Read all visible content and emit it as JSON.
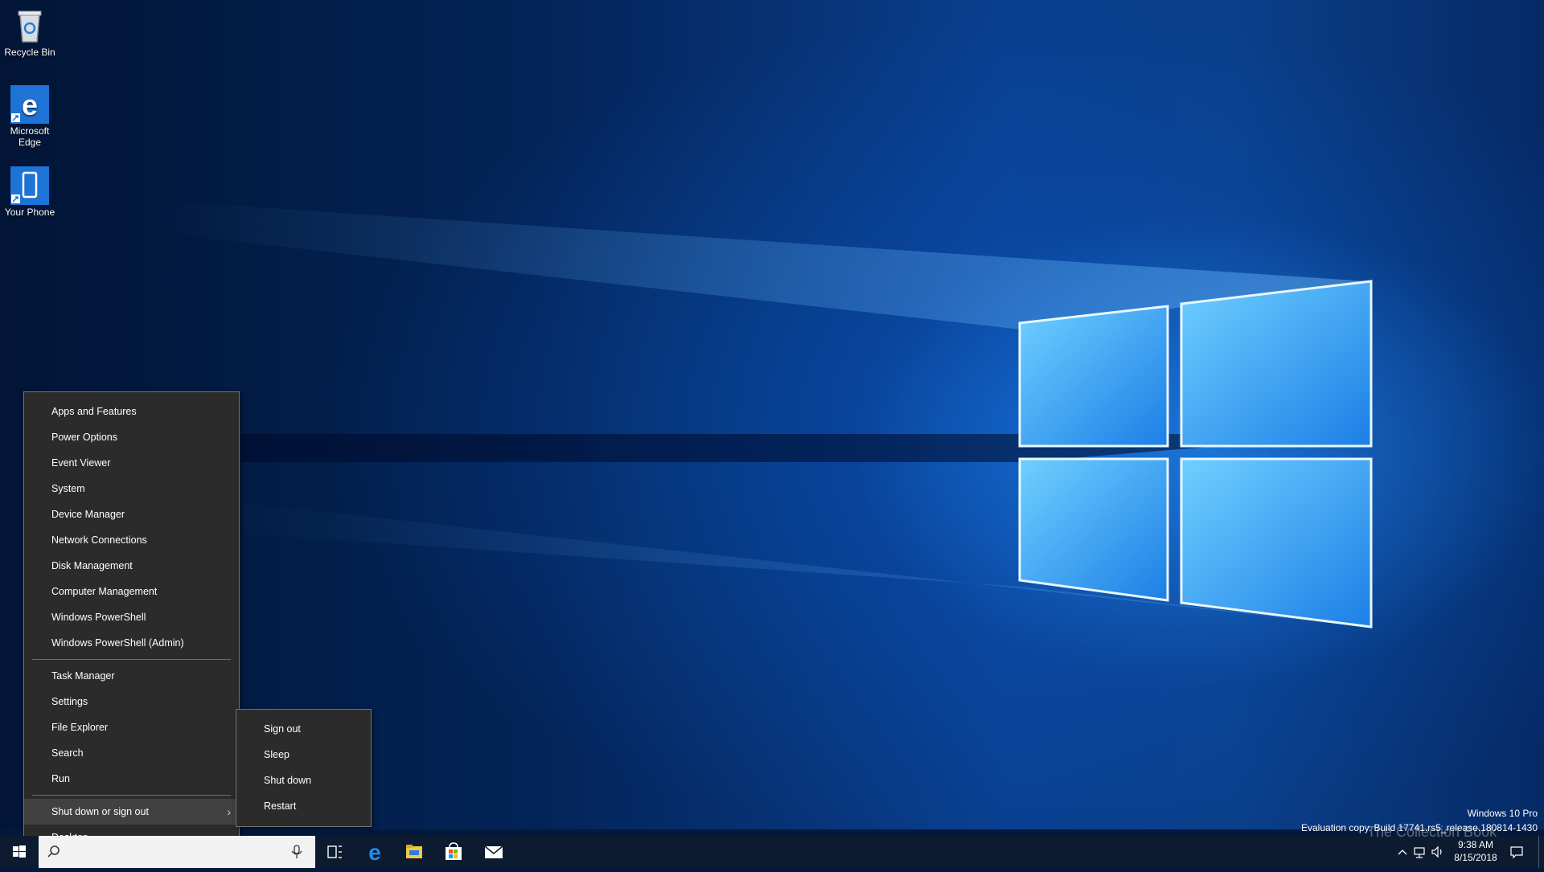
{
  "desktop": {
    "icons": [
      {
        "label": "Recycle Bin"
      },
      {
        "label": "Microsoft Edge"
      },
      {
        "label": "Your Phone"
      }
    ]
  },
  "winx_menu": {
    "items": [
      {
        "label": "Apps and Features"
      },
      {
        "label": "Power Options"
      },
      {
        "label": "Event Viewer"
      },
      {
        "label": "System"
      },
      {
        "label": "Device Manager"
      },
      {
        "label": "Network Connections"
      },
      {
        "label": "Disk Management"
      },
      {
        "label": "Computer Management"
      },
      {
        "label": "Windows PowerShell"
      },
      {
        "label": "Windows PowerShell (Admin)"
      },
      {
        "label": "Task Manager"
      },
      {
        "label": "Settings"
      },
      {
        "label": "File Explorer"
      },
      {
        "label": "Search"
      },
      {
        "label": "Run"
      },
      {
        "label": "Shut down or sign out"
      },
      {
        "label": "Desktop"
      }
    ]
  },
  "submenu": {
    "items": [
      {
        "label": "Sign out"
      },
      {
        "label": "Sleep"
      },
      {
        "label": "Shut down"
      },
      {
        "label": "Restart"
      }
    ]
  },
  "watermark": {
    "edition": "Windows 10 Pro",
    "build": "Evaluation copy. Build 17741.rs5_release.180814-1430"
  },
  "taskbar": {
    "pinned": [
      "start-icon",
      "microphone-icon",
      "task-view-icon",
      "edge-icon",
      "file-explorer-icon",
      "store-icon",
      "mail-icon"
    ],
    "time": "9:38 AM",
    "date": "8/15/2018"
  },
  "overlay_logo": "The Collection Book",
  "colors": {
    "menu_bg": "#2b2b2b",
    "menu_active": "#414141",
    "taskbar_bg": "#0c1b2f",
    "accent": "#0078d7"
  }
}
